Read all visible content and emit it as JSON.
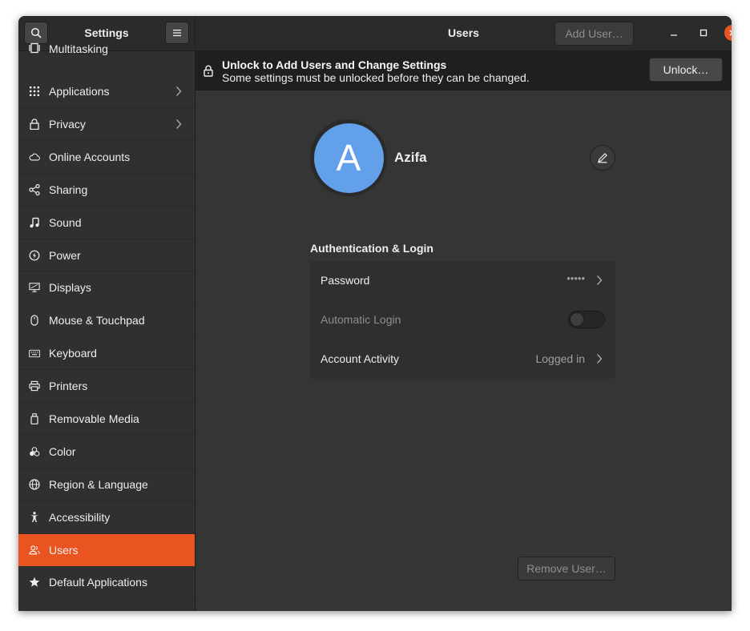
{
  "sidebar": {
    "title": "Settings",
    "items": [
      {
        "label": "Multitasking",
        "icon": "multitasking-icon"
      },
      {
        "label": "Applications",
        "icon": "applications-icon",
        "has_submenu": true
      },
      {
        "label": "Privacy",
        "icon": "lock-icon",
        "has_submenu": true
      },
      {
        "label": "Online Accounts",
        "icon": "cloud-icon"
      },
      {
        "label": "Sharing",
        "icon": "share-icon"
      },
      {
        "label": "Sound",
        "icon": "music-note-icon"
      },
      {
        "label": "Power",
        "icon": "power-icon"
      },
      {
        "label": "Displays",
        "icon": "display-icon"
      },
      {
        "label": "Mouse & Touchpad",
        "icon": "mouse-icon"
      },
      {
        "label": "Keyboard",
        "icon": "keyboard-icon"
      },
      {
        "label": "Printers",
        "icon": "printer-icon"
      },
      {
        "label": "Removable Media",
        "icon": "removable-media-icon"
      },
      {
        "label": "Color",
        "icon": "color-icon"
      },
      {
        "label": "Region & Language",
        "icon": "globe-icon"
      },
      {
        "label": "Accessibility",
        "icon": "accessibility-icon"
      },
      {
        "label": "Users",
        "icon": "users-icon",
        "active": true
      },
      {
        "label": "Default Applications",
        "icon": "star-icon"
      }
    ]
  },
  "header": {
    "title": "Users",
    "add_user_label": "Add User…"
  },
  "infobar": {
    "title": "Unlock to Add Users and Change Settings",
    "subtitle": "Some settings must be unlocked before they can be changed.",
    "unlock_label": "Unlock…"
  },
  "user": {
    "initial": "A",
    "name": "Azifa",
    "avatar_color": "#62a0ea"
  },
  "auth": {
    "section_title": "Authentication & Login",
    "password_label": "Password",
    "password_value": "•••••",
    "automatic_login_label": "Automatic Login",
    "automatic_login_enabled": false,
    "account_activity_label": "Account Activity",
    "account_activity_value": "Logged in"
  },
  "remove_user_label": "Remove User…",
  "colors": {
    "accent": "#e95420",
    "background": "#353535",
    "sidebar": "#303030"
  }
}
